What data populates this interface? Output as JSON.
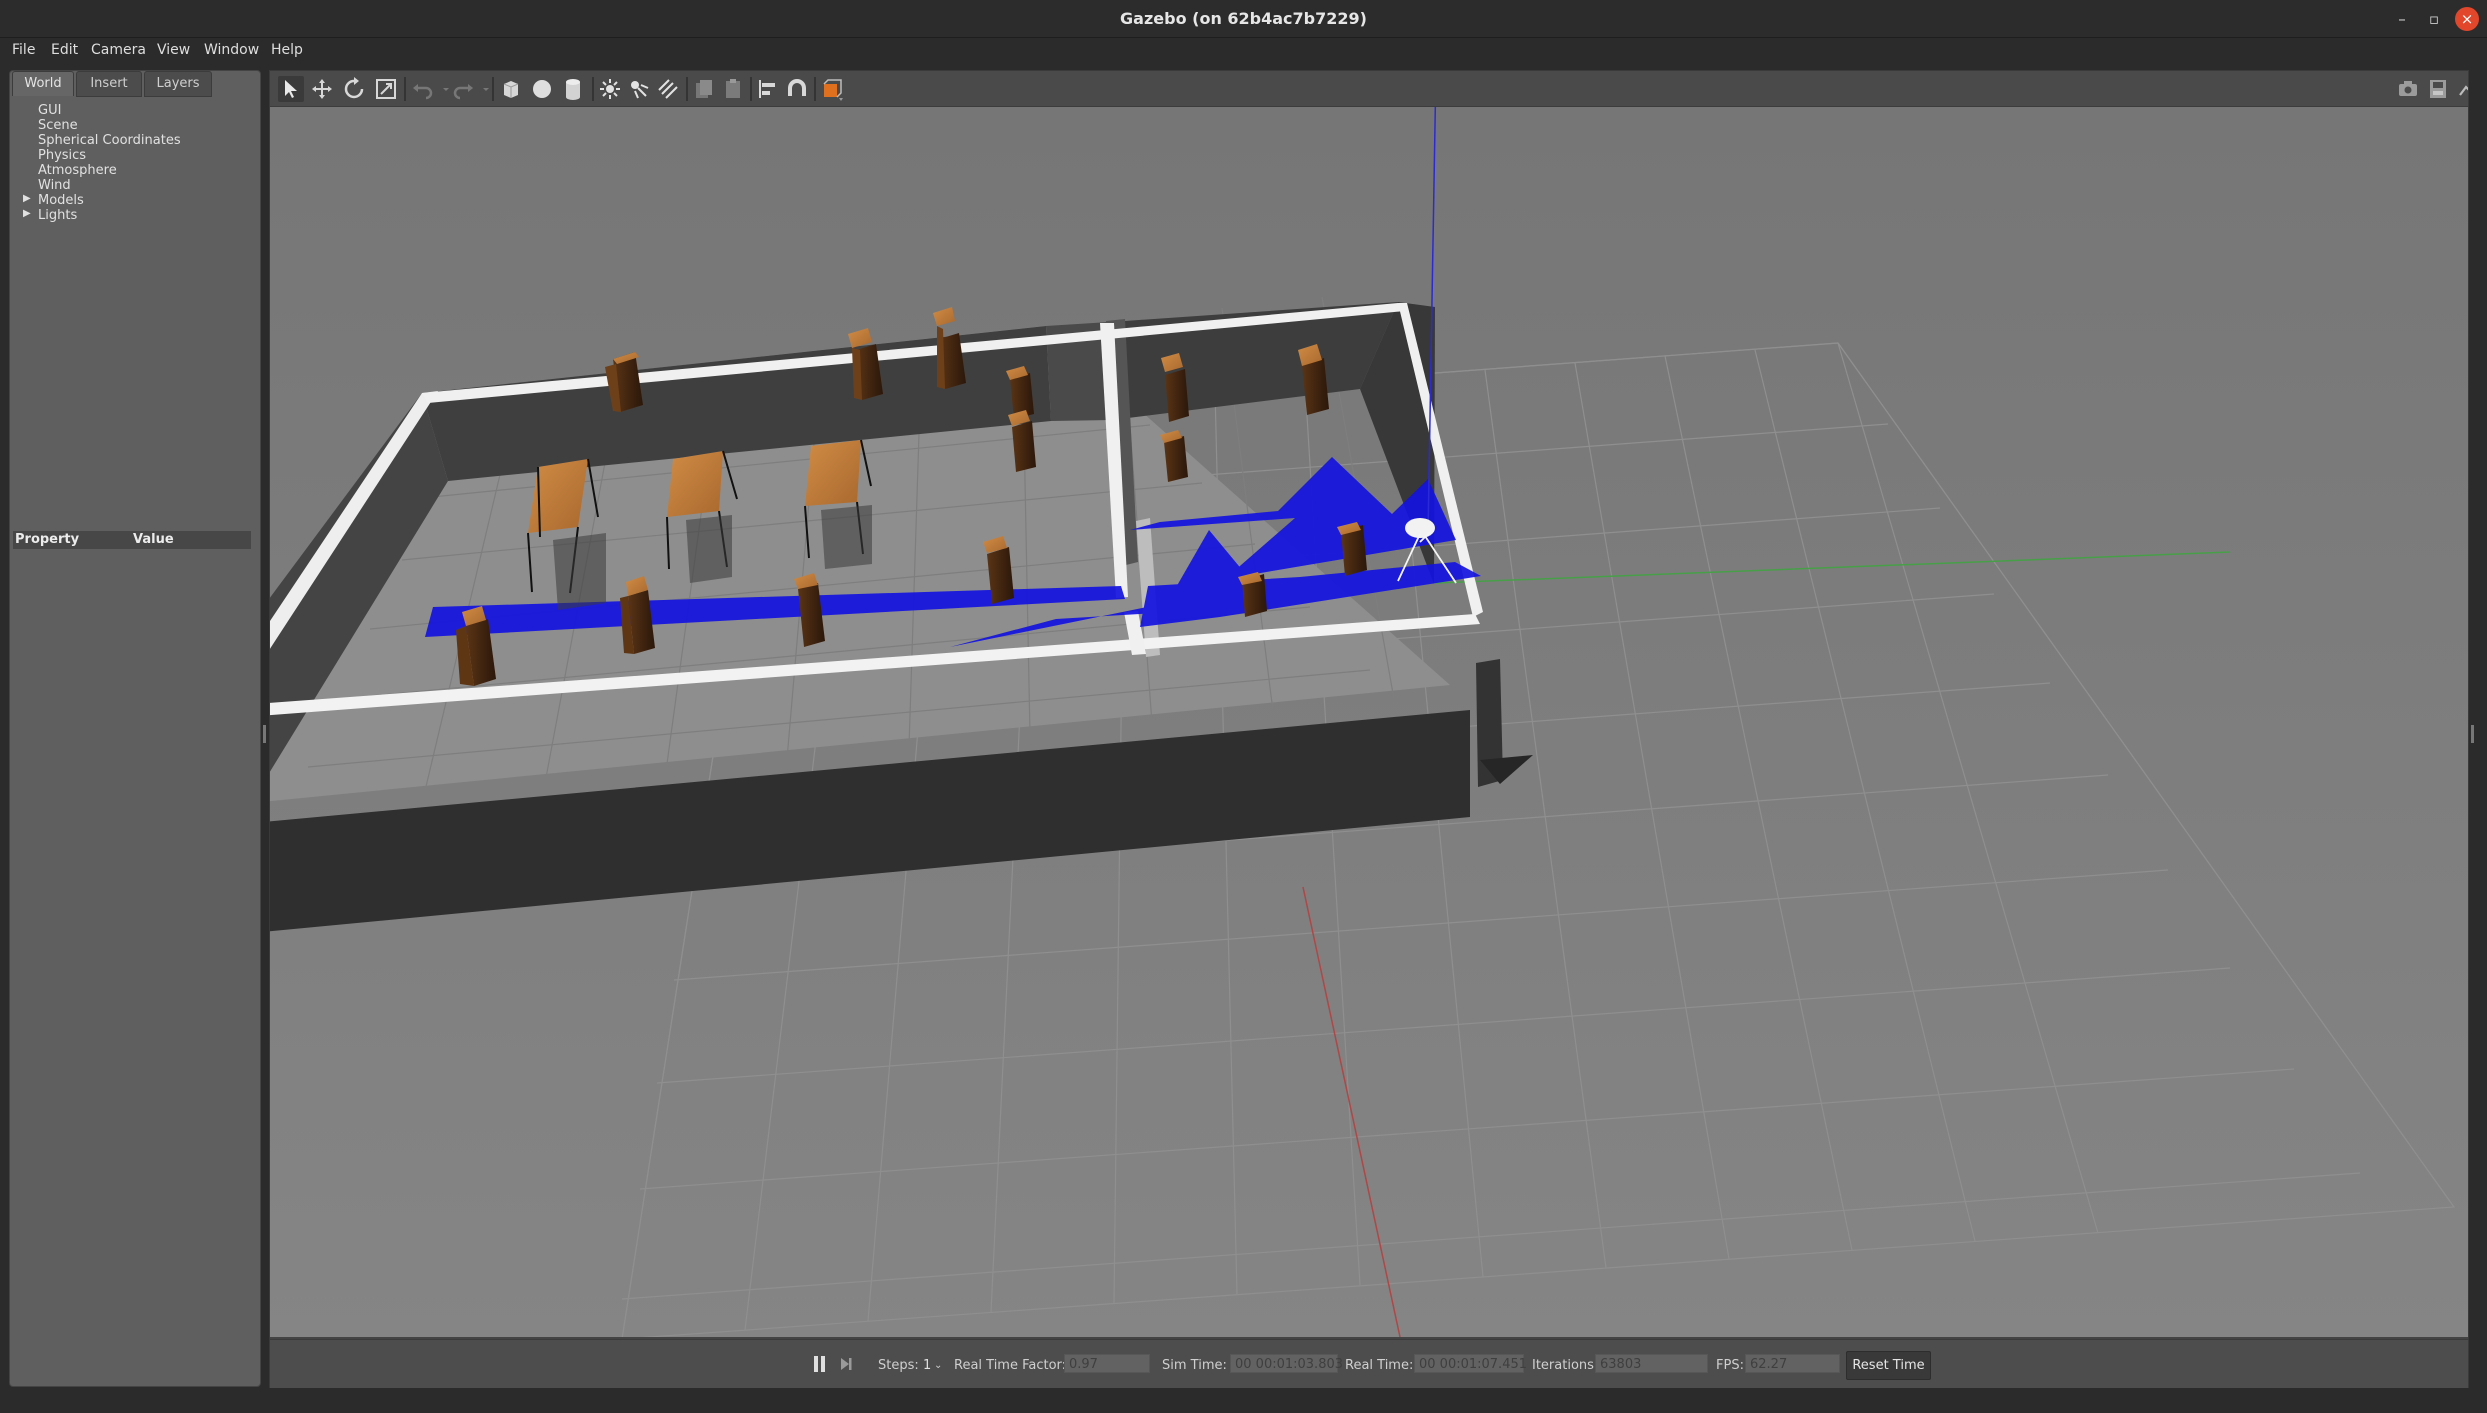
{
  "window": {
    "title": "Gazebo (on 62b4ac7b7229)",
    "minimize_glyph": "–",
    "maximize_glyph": "▫",
    "close_glyph": "×"
  },
  "menu": {
    "file": "File",
    "edit": "Edit",
    "camera": "Camera",
    "view": "View",
    "window": "Window",
    "help": "Help"
  },
  "left_panel": {
    "tabs": [
      "World",
      "Insert",
      "Layers"
    ],
    "tree": [
      "GUI",
      "Scene",
      "Spherical Coordinates",
      "Physics",
      "Atmosphere",
      "Wind",
      "Models",
      "Lights"
    ],
    "property_header": "Property",
    "value_header": "Value"
  },
  "toolbar": {
    "left_icons": [
      "select-arrow-icon",
      "translate-icon",
      "rotate-icon",
      "scale-icon",
      "undo-icon",
      "redo-icon",
      "box-icon",
      "sphere-icon",
      "cylinder-icon",
      "point-light-icon",
      "spot-light-icon",
      "directional-light-icon",
      "copy-icon",
      "paste-icon",
      "align-icon",
      "snap-magnet-icon",
      "view-angle-icon"
    ],
    "right_icons": [
      "screenshot-camera-icon",
      "log-icon",
      "plot-icon",
      "video-record-icon"
    ]
  },
  "bottom_bar": {
    "steps_label": "Steps:",
    "steps_value": "1",
    "real_time_factor_label": "Real Time Factor:",
    "real_time_factor_value": "0.97",
    "sim_time_label": "Sim Time:",
    "sim_time_value": "00 00:01:03.803",
    "real_time_label": "Real Time:",
    "real_time_value": "00 00:01:07.451",
    "iterations_label": "Iterations:",
    "iterations_value": "63803",
    "fps_label": "FPS:",
    "fps_value": "62.27",
    "reset_time_label": "Reset Time"
  },
  "colors": {
    "laser": "#1212e6",
    "wall_top": "#f2f2f2",
    "wall_side": "#3c3c3c",
    "floor": "#8a8a8a",
    "wood": "#b9773a",
    "window_close": "#e2462b"
  }
}
